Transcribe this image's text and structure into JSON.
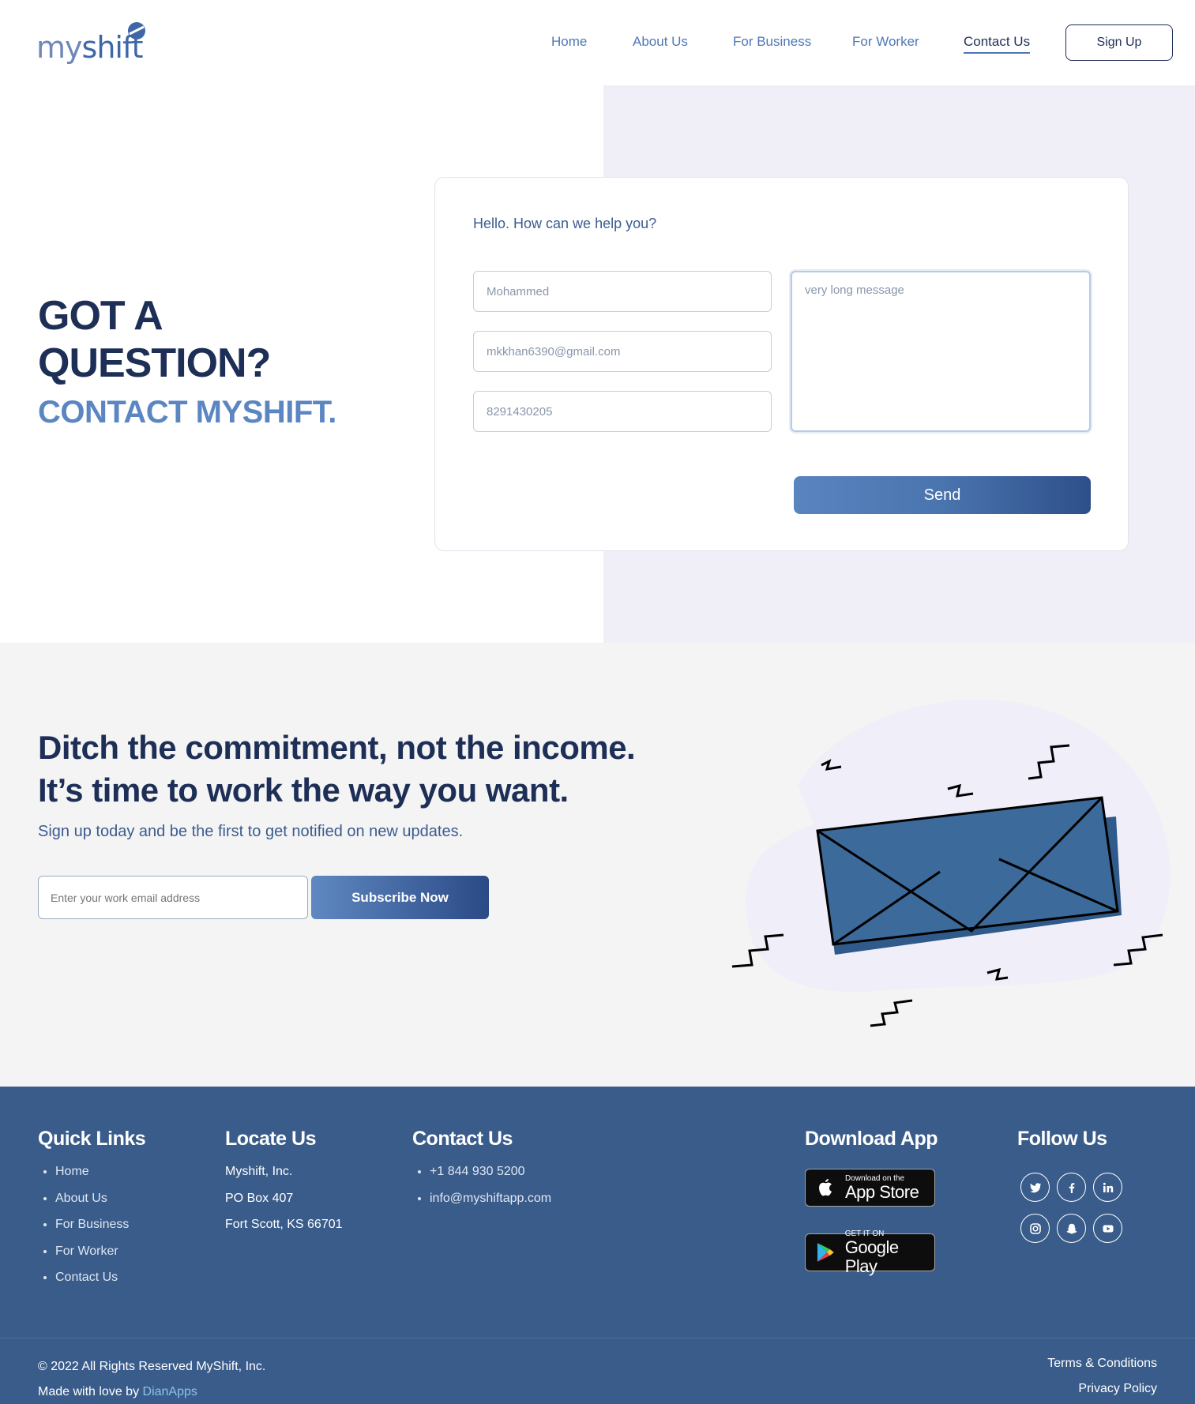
{
  "brand": {
    "logo_text_my": "my",
    "logo_text_shift": "shift",
    "logo_icon": "myshift-logo-icon"
  },
  "nav": {
    "items": [
      {
        "label": "Home"
      },
      {
        "label": "About Us"
      },
      {
        "label": "For Business"
      },
      {
        "label": "For Worker"
      },
      {
        "label": "Contact Us",
        "active": true
      }
    ],
    "signup_label": "Sign Up"
  },
  "hero": {
    "heading_line1": "GOT A",
    "heading_line2": "QUESTION?",
    "subheading": "CONTACT MYSHIFT."
  },
  "contact_form": {
    "title": "Hello. How can we help you?",
    "name_value": "Mohammed",
    "email_value": "mkkhan6390@gmail.com",
    "phone_value": "8291430205",
    "message_value": "very long message",
    "send_label": "Send"
  },
  "subscribe": {
    "heading_line1": "Ditch the commitment, not the income.",
    "heading_line2": "It’s time to work the way you want.",
    "text": "Sign up today and be the first to get notified on new updates.",
    "email_placeholder": "Enter your work email address",
    "button_label": "Subscribe Now",
    "illustration_icon": "envelope-icon"
  },
  "footer": {
    "quick_links": {
      "title": "Quick Links",
      "items": [
        "Home",
        "About Us",
        "For Business",
        "For Worker",
        "Contact Us"
      ]
    },
    "locate": {
      "title": "Locate Us",
      "lines": [
        "Myshift, Inc.",
        "PO Box 407",
        "Fort Scott, KS 66701"
      ]
    },
    "contact": {
      "title": "Contact Us",
      "phone": "+1 844 930 5200",
      "email": "info@myshiftapp.com"
    },
    "download": {
      "title": "Download App",
      "app_store_small": "Download on the",
      "app_store_big": "App Store",
      "google_small": "GET IT ON",
      "google_big": "Google Play"
    },
    "follow": {
      "title": "Follow Us",
      "icons": [
        "twitter-icon",
        "facebook-icon",
        "linkedin-icon",
        "instagram-icon",
        "snapchat-icon",
        "youtube-icon"
      ]
    },
    "copyright": "© 2022 All Rights Reserved MyShift, Inc.",
    "made_prefix": "Made with love by ",
    "made_link": "DianApps",
    "terms": "Terms & Conditions",
    "privacy": "Privacy Policy"
  },
  "colors": {
    "navy": "#1e2f57",
    "accent_blue": "#4f77b6",
    "light_blue": "#5c86c2",
    "hero_tint": "#f0eff8",
    "subscribe_bg": "#f4f4f4",
    "footer_bg": "#3a5c8a",
    "envelope": "#3b6a9b"
  }
}
